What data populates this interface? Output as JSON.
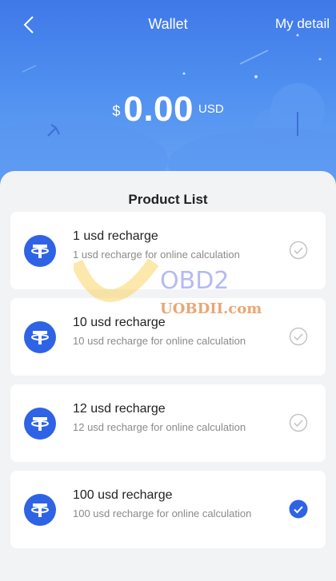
{
  "header": {
    "title": "Wallet",
    "my_detail": "My detail",
    "back_icon": "chevron-left-icon"
  },
  "balance": {
    "currency_symbol": "$",
    "amount": "0.00",
    "unit": "USD"
  },
  "products": {
    "heading": "Product List",
    "items": [
      {
        "name": "1 usd recharge",
        "description": "1 usd recharge for online calculation",
        "selected": false
      },
      {
        "name": "10 usd recharge",
        "description": "10 usd recharge for online calculation",
        "selected": false
      },
      {
        "name": "12 usd recharge",
        "description": "12 usd recharge for online calculation",
        "selected": false
      },
      {
        "name": "100 usd recharge",
        "description": "100 usd recharge for online calculation",
        "selected": true
      }
    ]
  },
  "watermark": {
    "brand": "OBD2",
    "site": "UOBDII.com"
  },
  "colors": {
    "header_blue": "#3f78e8",
    "logo_blue": "#2f63e5",
    "check_selected": "#2f63e5",
    "check_unselected": "#c4c4c4"
  }
}
